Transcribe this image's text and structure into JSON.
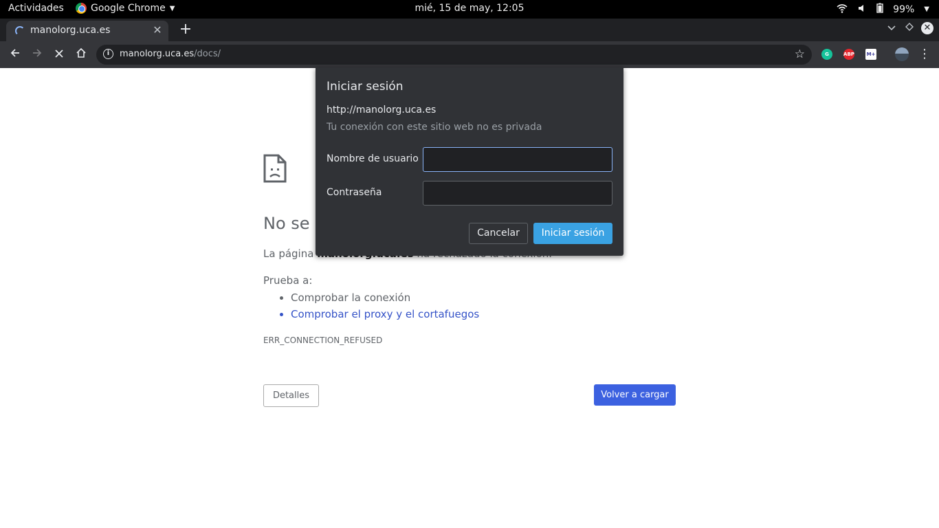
{
  "topbar": {
    "activities": "Actividades",
    "app_name": "Google Chrome",
    "clock": "mié, 15 de may, 12:05",
    "battery": "99%"
  },
  "tabs": [
    {
      "title": "manolorg.uca.es",
      "loading": true
    }
  ],
  "omnibox": {
    "host": "manolorg.uca.es",
    "path": "/docs/"
  },
  "extensions": {
    "grammarly": "G",
    "abp": "ABP",
    "third": "M+"
  },
  "error_page": {
    "title_visible": "No se",
    "desc_prefix": "La página",
    "desc_host": "manolorg.uca.es",
    "desc_suffix": "ha rechazado la conexión.",
    "try_label": "Prueba a:",
    "suggestions": [
      "Comprobar la conexión",
      "Comprobar el proxy y el cortafuegos"
    ],
    "error_code": "ERR_CONNECTION_REFUSED",
    "details_button": "Detalles",
    "reload_button": "Volver a cargar"
  },
  "auth_dialog": {
    "title": "Iniciar sesión",
    "origin": "http://manolorg.uca.es",
    "privacy_note": "Tu conexión con este sitio web no es privada",
    "username_label": "Nombre de usuario",
    "username_value": "",
    "password_label": "Contraseña",
    "password_value": "",
    "cancel_button": "Cancelar",
    "submit_button": "Iniciar sesión"
  },
  "colors": {
    "reload_button": "#3c61e0",
    "dialog_submit": "#3aa2e3",
    "link": "#3452c7"
  }
}
